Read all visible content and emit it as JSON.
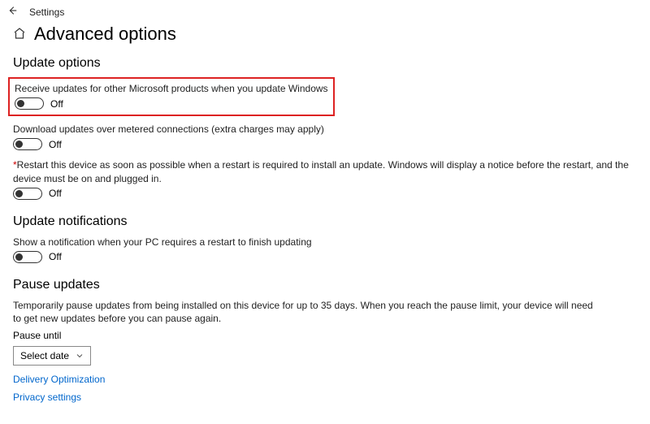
{
  "topbar": {
    "title": "Settings"
  },
  "page": {
    "title": "Advanced options"
  },
  "updateOptions": {
    "heading": "Update options",
    "opt1": {
      "label": "Receive updates for other Microsoft products when you update Windows",
      "state": "Off"
    },
    "opt2": {
      "label": "Download updates over metered connections (extra charges may apply)",
      "state": "Off"
    },
    "opt3": {
      "label": "Restart this device as soon as possible when a restart is required to install an update. Windows will display a notice before the restart, and the device must be on and plugged in.",
      "state": "Off"
    }
  },
  "updateNotifications": {
    "heading": "Update notifications",
    "opt1": {
      "label": "Show a notification when your PC requires a restart to finish updating",
      "state": "Off"
    }
  },
  "pauseUpdates": {
    "heading": "Pause updates",
    "desc": "Temporarily pause updates from being installed on this device for up to 35 days. When you reach the pause limit, your device will need to get new updates before you can pause again.",
    "pauseUntilLabel": "Pause until",
    "dropdown": "Select date"
  },
  "links": {
    "delivery": "Delivery Optimization",
    "privacy": "Privacy settings"
  }
}
